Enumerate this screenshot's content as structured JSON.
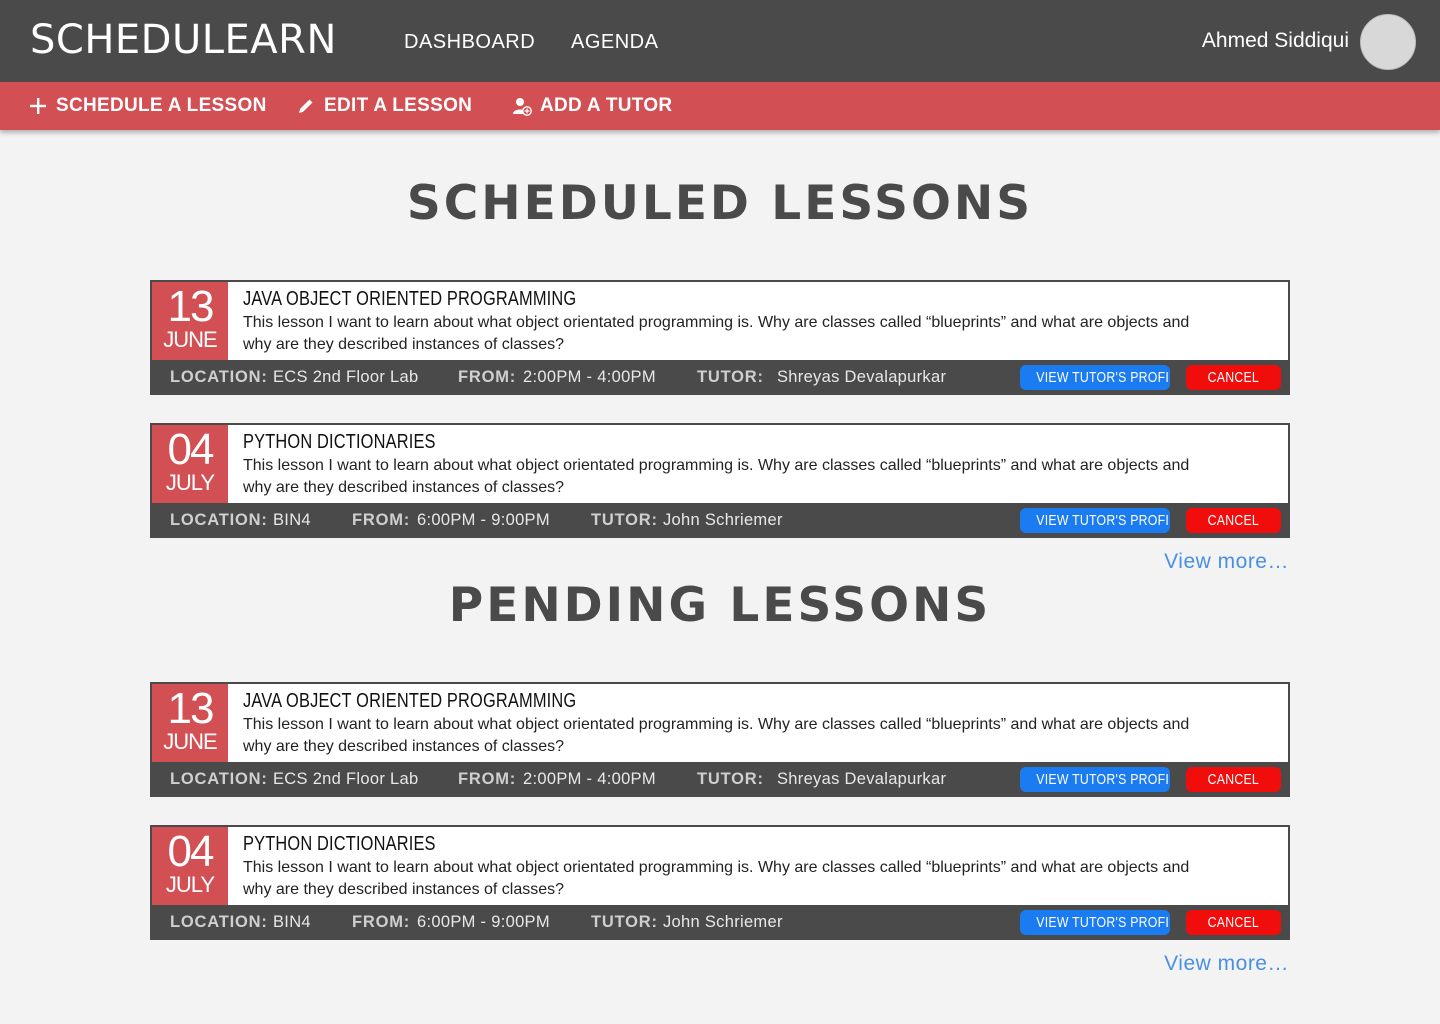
{
  "app": {
    "logo": "SCHEDULEARN",
    "nav": [
      {
        "label": "DASHBOARD"
      },
      {
        "label": "AGENDA"
      }
    ],
    "user": {
      "name": "Ahmed Siddiqui"
    }
  },
  "actions": {
    "schedule": {
      "label": "SCHEDULE A LESSON",
      "icon": "plus-icon"
    },
    "edit": {
      "label": "EDIT A LESSON",
      "icon": "pencil-icon"
    },
    "add_tutor": {
      "label": "ADD A TUTOR",
      "icon": "add-user-icon"
    }
  },
  "labels": {
    "location": "LOCATION:",
    "from": "FROM:",
    "tutor": "TUTOR:",
    "view_profile": "VIEW TUTOR'S PROFILE",
    "cancel": "CANCEL",
    "view_more": "View more…"
  },
  "colors": {
    "topbar": "#4a4a4a",
    "accent": "#d24f54",
    "profile_button": "#1a7cf0",
    "cancel_button": "#f20d0d",
    "link": "#4a90e2"
  },
  "sections": [
    {
      "title": "SCHEDULED LESSONS",
      "lessons": [
        {
          "day": "13",
          "month": "JUNE",
          "title": "JAVA OBJECT ORIENTED PROGRAMMING",
          "description": "This lesson I want to learn about what object orientated programming is. Why are classes called “blueprints” and what are objects and why are they described instances of classes?",
          "location": "ECS 2nd Floor Lab",
          "time": "2:00PM - 4:00PM",
          "tutor": "Shreyas Devalapurkar"
        },
        {
          "day": "04",
          "month": "JULY",
          "title": "PYTHON DICTIONARIES",
          "description": "This lesson I want to learn about what object orientated programming is. Why are classes called “blueprints” and what are objects and why are they described instances of classes?",
          "location": "BIN4",
          "time": "6:00PM - 9:00PM",
          "tutor": "John Schriemer"
        }
      ]
    },
    {
      "title": "PENDING LESSONS",
      "lessons": [
        {
          "day": "13",
          "month": "JUNE",
          "title": "JAVA OBJECT ORIENTED PROGRAMMING",
          "description": "This lesson I want to learn about what object orientated programming is. Why are classes called “blueprints” and what are objects and why are they described instances of classes?",
          "location": "ECS 2nd Floor Lab",
          "time": "2:00PM - 4:00PM",
          "tutor": "Shreyas Devalapurkar"
        },
        {
          "day": "04",
          "month": "JULY",
          "title": "PYTHON DICTIONARIES",
          "description": "This lesson I want to learn about what object orientated programming is. Why are classes called “blueprints” and what are objects and why are they described instances of classes?",
          "location": "BIN4",
          "time": "6:00PM - 9:00PM",
          "tutor": "John Schriemer"
        }
      ]
    }
  ]
}
